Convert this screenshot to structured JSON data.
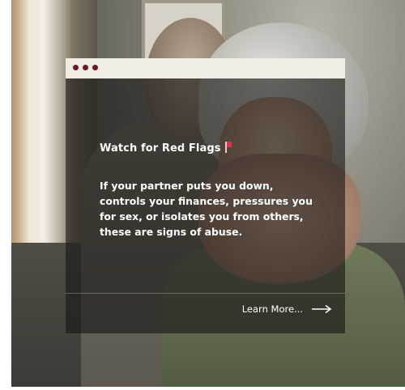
{
  "card": {
    "window_dots": [
      "red-dot",
      "red-dot",
      "red-dot"
    ],
    "title": "Watch for Red Flags",
    "title_icon": "red-flag-icon",
    "body": "If your partner puts you down, controls your finances, pressures you for sex, or isolates you from others, these are signs of abuse.",
    "cta_label": "Learn More...",
    "cta_icon": "arrow-right-icon"
  },
  "colors": {
    "titlebar": "#f1ede3",
    "dot": "#6d1a23",
    "flag": "#e0314b",
    "overlay": "#19171399",
    "text": "#ffffff"
  }
}
